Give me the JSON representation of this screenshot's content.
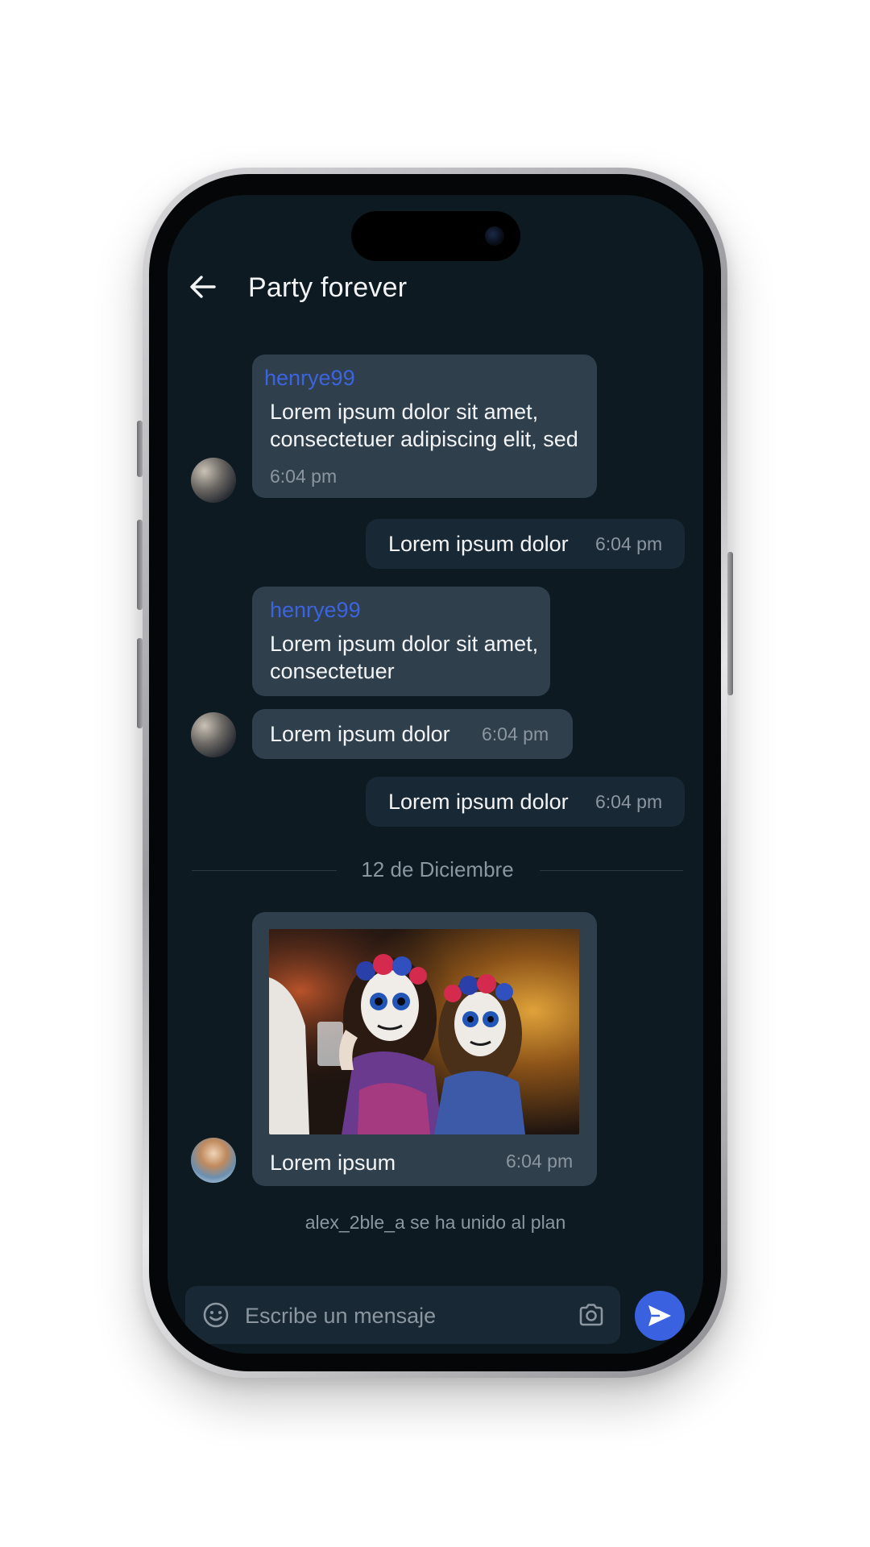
{
  "header": {
    "title": "Party forever",
    "back_icon": "arrow-left-icon"
  },
  "messages": [
    {
      "direction": "incoming",
      "sender": "henrye99",
      "text_lines": [
        "Lorem ipsum dolor sit amet,",
        "consectetuer adipiscing elit, sed"
      ],
      "time": "6:04 pm"
    },
    {
      "direction": "outgoing",
      "text": "Lorem ipsum dolor",
      "time": "6:04 pm"
    },
    {
      "direction": "incoming",
      "sender": "henrye99",
      "text_lines": [
        "Lorem ipsum dolor sit amet,",
        "consectetuer"
      ]
    },
    {
      "direction": "incoming",
      "text": "Lorem ipsum dolor",
      "time": "6:04 pm"
    },
    {
      "direction": "outgoing",
      "text": "Lorem ipsum dolor",
      "time": "6:04 pm"
    },
    {
      "direction": "incoming",
      "type": "image",
      "caption": "Lorem ipsum",
      "time": "6:04 pm"
    }
  ],
  "date_separator": "12 de Diciembre",
  "system_note": "alex_2ble_a se ha unido al plan",
  "composer": {
    "placeholder": "Escribe un mensaje",
    "emoji_icon": "emoji-smile-icon",
    "camera_icon": "camera-icon",
    "send_icon": "send-icon"
  },
  "colors": {
    "background": "#0e1a22",
    "incoming_bubble": "#2f3f4c",
    "outgoing_bubble": "#182834",
    "sender_name": "#3d64e0",
    "send_button": "#3a62e0",
    "muted_text": "#8b96a0"
  }
}
